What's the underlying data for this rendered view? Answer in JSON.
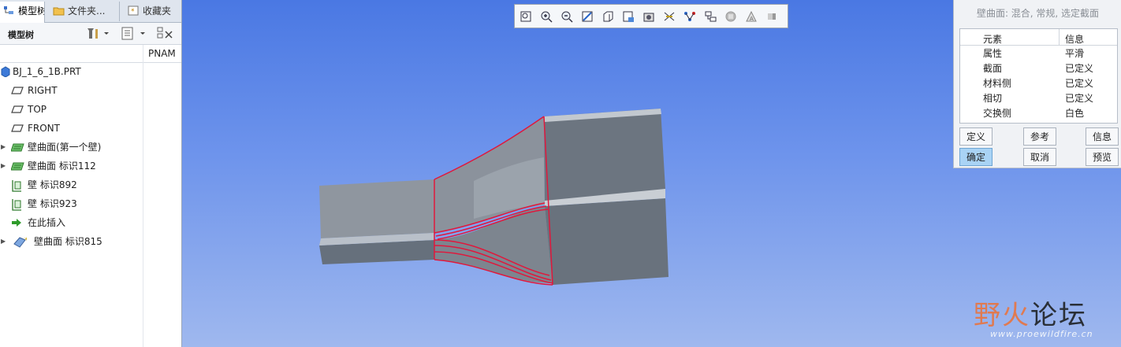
{
  "tabs": [
    {
      "label": "模型树",
      "icon": "tree-icon"
    },
    {
      "label": "文件夹...",
      "icon": "folder-icon"
    },
    {
      "label": "收藏夹",
      "icon": "favorites-icon"
    }
  ],
  "model_tree": {
    "title": "模型树",
    "column_header": "PNAM",
    "items": [
      {
        "label": "BJ_1_6_1B.PRT",
        "icon": "part-icon",
        "expandable": false
      },
      {
        "label": "RIGHT",
        "icon": "datum-plane-icon",
        "expandable": false
      },
      {
        "label": "TOP",
        "icon": "datum-plane-icon",
        "expandable": false
      },
      {
        "label": "FRONT",
        "icon": "datum-plane-icon",
        "expandable": false
      },
      {
        "label": "壁曲面(第一个壁)",
        "icon": "wall-surface-icon",
        "expandable": true
      },
      {
        "label": "壁曲面 标识112",
        "icon": "wall-surface-icon",
        "expandable": true
      },
      {
        "label": "壁 标识892",
        "icon": "wall-icon",
        "expandable": false
      },
      {
        "label": "壁 标识923",
        "icon": "wall-icon",
        "expandable": false
      },
      {
        "label": "在此插入",
        "icon": "insert-here-arrow-icon",
        "expandable": false
      },
      {
        "label": "壁曲面 标识815",
        "icon": "wall-surface-new-icon",
        "expandable": true
      }
    ]
  },
  "view_toolbar": {
    "buttons": [
      "refit-icon",
      "zoom-in-icon",
      "zoom-out-icon",
      "repaint-icon",
      "display-style-icon",
      "saved-views-icon",
      "view-manager-icon",
      "datum-planes-icon",
      "datum-axes-icon",
      "datum-points-icon",
      "coordinate-systems-icon",
      "annotations-icon",
      "spin-center-icon"
    ]
  },
  "dialog": {
    "title": "壁曲面: 混合, 常规, 选定截面",
    "columns": [
      "元素",
      "信息"
    ],
    "rows": [
      {
        "element": "属性",
        "info": "平滑"
      },
      {
        "element": "截面",
        "info": "已定义"
      },
      {
        "element": "材料侧",
        "info": "已定义"
      },
      {
        "element": "相切",
        "info": "已定义"
      },
      {
        "element": "交换侧",
        "info": "白色"
      }
    ],
    "buttons": {
      "define": "定义",
      "refs": "参考",
      "info": "信息",
      "ok": "确定",
      "cancel": "取消",
      "preview": "预览"
    }
  },
  "watermark": {
    "text_red": "野火",
    "text_dark": "论坛",
    "url": "www.proewildfire.cn"
  },
  "colors": {
    "viewport_top": "#4a78e3",
    "viewport_bottom": "#9fb8ee",
    "edge_highlight": "#e0183c",
    "ok_button": "#a9d3f5"
  }
}
